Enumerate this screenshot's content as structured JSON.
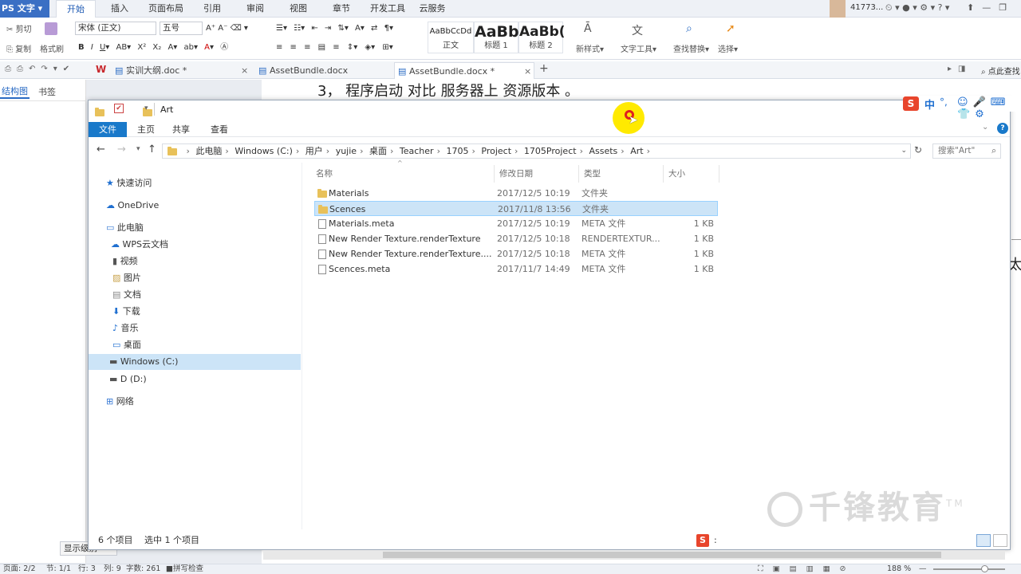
{
  "wps": {
    "app_name": "PS 文字",
    "menu": [
      "开始",
      "插入",
      "页面布局",
      "引用",
      "审阅",
      "视图",
      "章节",
      "开发工具",
      "云服务"
    ],
    "user": "41773...",
    "ribbon": {
      "cut": "剪切",
      "copy": "复制",
      "format_painter": "格式刷",
      "font_name": "宋体 (正文)",
      "font_size": "五号",
      "styles": [
        {
          "preview": "AaBbCcDd",
          "label": "正文"
        },
        {
          "preview": "AaBb",
          "label": "标题 1"
        },
        {
          "preview": "AaBb(",
          "label": "标题 2"
        }
      ],
      "new_style": "新样式",
      "text_tools": "文字工具",
      "find_replace": "查找替换",
      "select": "选择"
    },
    "tabs": [
      {
        "label": "实训大纲.doc *"
      },
      {
        "label": "AssetBundle.docx"
      },
      {
        "label": "AssetBundle.docx *"
      }
    ],
    "search_hint": "点此查找",
    "left_panel": {
      "tab1": "结构图",
      "tab2": "书签"
    },
    "doc_text": "3，   程序启动 对比 服务器上 资源版本 。",
    "doc_right_char": "太",
    "status": {
      "page": "页面: 2/2",
      "section": "节: 1/1",
      "row": "行: 3",
      "col": "列: 9",
      "words": "字数: 261",
      "spell": "拼写检查",
      "zoom": "188 %",
      "display_level": "显示级别"
    }
  },
  "explorer": {
    "title": "Art",
    "ribbon_tabs": [
      "文件",
      "主页",
      "共享",
      "查看"
    ],
    "breadcrumb": [
      "此电脑",
      "Windows (C:)",
      "用户",
      "yujie",
      "桌面",
      "Teacher",
      "1705",
      "Project",
      "1705Project",
      "Assets",
      "Art"
    ],
    "search_placeholder": "搜索\"Art\"",
    "nav": [
      {
        "label": "快速访问",
        "icon": "star-icon",
        "indent": 0
      },
      {
        "label": "OneDrive",
        "icon": "cloud-icon",
        "indent": 0
      },
      {
        "label": "此电脑",
        "icon": "computer-icon",
        "indent": 0
      },
      {
        "label": "WPS云文档",
        "icon": "cloud-icon",
        "indent": 1
      },
      {
        "label": "视频",
        "icon": "video-icon",
        "indent": 1
      },
      {
        "label": "图片",
        "icon": "picture-icon",
        "indent": 1
      },
      {
        "label": "文档",
        "icon": "document-icon",
        "indent": 1
      },
      {
        "label": "下载",
        "icon": "download-icon",
        "indent": 1
      },
      {
        "label": "音乐",
        "icon": "music-icon",
        "indent": 1
      },
      {
        "label": "桌面",
        "icon": "desktop-icon",
        "indent": 1
      },
      {
        "label": "Windows (C:)",
        "icon": "drive-icon",
        "indent": 1,
        "selected": true
      },
      {
        "label": "D (D:)",
        "icon": "drive-icon",
        "indent": 1
      },
      {
        "label": "网络",
        "icon": "network-icon",
        "indent": 0
      }
    ],
    "columns": {
      "name": "名称",
      "date": "修改日期",
      "type": "类型",
      "size": "大小"
    },
    "files": [
      {
        "name": "Materials",
        "date": "2017/12/5 10:19",
        "type": "文件夹",
        "size": "",
        "kind": "folder"
      },
      {
        "name": "Scences",
        "date": "2017/11/8 13:56",
        "type": "文件夹",
        "size": "",
        "kind": "folder",
        "selected": true
      },
      {
        "name": "Materials.meta",
        "date": "2017/12/5 10:19",
        "type": "META 文件",
        "size": "1 KB",
        "kind": "file"
      },
      {
        "name": "New Render Texture.renderTexture",
        "date": "2017/12/5 10:18",
        "type": "RENDERTEXTUR...",
        "size": "1 KB",
        "kind": "file"
      },
      {
        "name": "New Render Texture.renderTexture....",
        "date": "2017/12/5 10:18",
        "type": "META 文件",
        "size": "1 KB",
        "kind": "file"
      },
      {
        "name": "Scences.meta",
        "date": "2017/11/7 14:49",
        "type": "META 文件",
        "size": "1 KB",
        "kind": "file"
      }
    ],
    "status_count": "6 个项目",
    "status_selected": "选中 1 个项目"
  },
  "ime": {
    "lang": "中",
    "punct": "°,"
  },
  "watermark": "千锋教育",
  "watermark_tm": "TM"
}
